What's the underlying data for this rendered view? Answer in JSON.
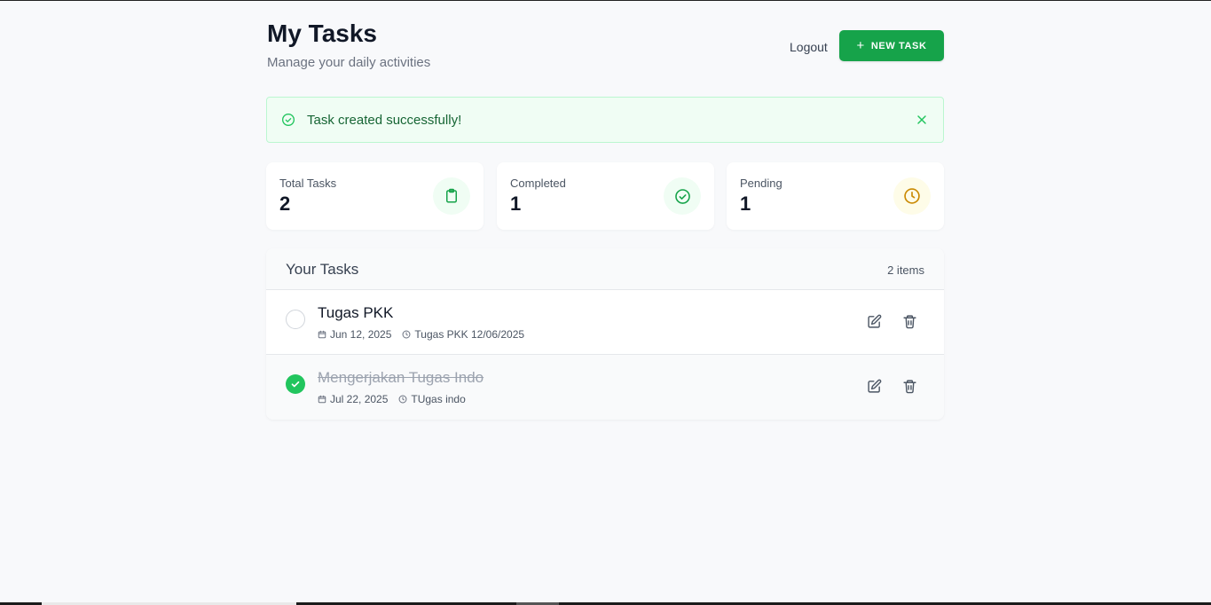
{
  "header": {
    "title": "My Tasks",
    "subtitle": "Manage your daily activities",
    "logout_label": "Logout",
    "new_task_label": "NEW TASK"
  },
  "alert": {
    "message": "Task created successfully!",
    "icon": "check-circle-icon",
    "close_icon": "close-icon"
  },
  "stats": [
    {
      "label": "Total Tasks",
      "value": "2",
      "icon": "clipboard-icon",
      "color": "#16a34a",
      "bg": "#f0fdf4"
    },
    {
      "label": "Completed",
      "value": "1",
      "icon": "check-circle-icon",
      "color": "#16a34a",
      "bg": "#f0fdf4"
    },
    {
      "label": "Pending",
      "value": "1",
      "icon": "clock-icon",
      "color": "#ca8a04",
      "bg": "#fefce8"
    }
  ],
  "tasks_panel": {
    "title": "Your Tasks",
    "count_label": "2 items",
    "tasks": [
      {
        "title": "Tugas PKK",
        "date": "Jun 12, 2025",
        "note": "Tugas PKK 12/06/2025",
        "completed": false
      },
      {
        "title": "Mengerjakan Tugas Indo",
        "date": "Jul 22, 2025",
        "note": "TUgas indo",
        "completed": true
      }
    ]
  },
  "colors": {
    "accent": "#16a34a",
    "success_check": "#22c55e",
    "pending": "#ca8a04"
  }
}
